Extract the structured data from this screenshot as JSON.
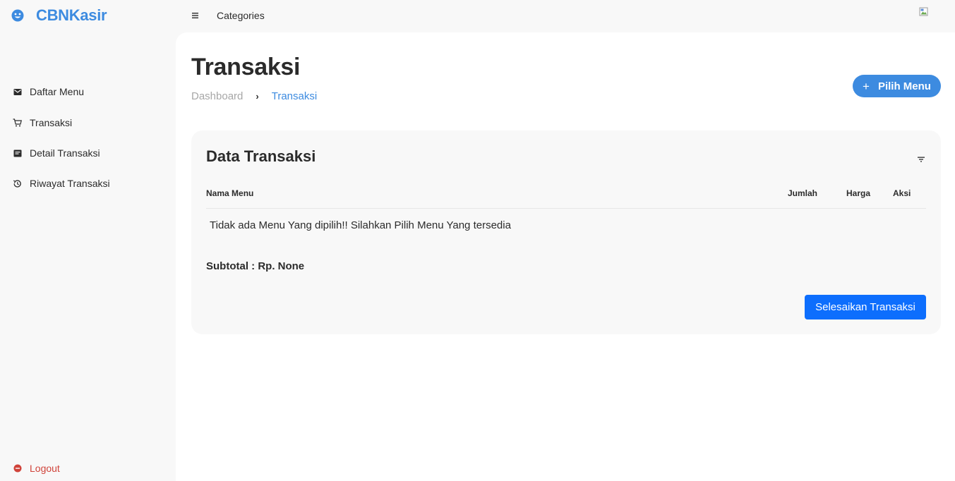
{
  "app": {
    "brand_name": "CBNKasir",
    "accent_color": "#3d8be0"
  },
  "topbar": {
    "menu_icon": "hamburger-icon",
    "link_label": "Categories"
  },
  "sidebar": {
    "items": [
      {
        "label": "Daftar Menu",
        "icon": "mail-icon"
      },
      {
        "label": "Transaksi",
        "icon": "cart-icon"
      },
      {
        "label": "Detail Transaksi",
        "icon": "receipt-icon"
      },
      {
        "label": "Riwayat Transaksi",
        "icon": "history-icon"
      }
    ],
    "logout_label": "Logout",
    "logout_color": "#d0433a"
  },
  "page": {
    "title": "Transaksi",
    "breadcrumb": {
      "home": "Dashboard",
      "separator": "›",
      "current": "Transaksi"
    },
    "pick_button": {
      "icon": "+",
      "label": "Pilih Menu"
    }
  },
  "card": {
    "title": "Data Transaksi",
    "table": {
      "columns": [
        "Nama Menu",
        "Jumlah",
        "Harga",
        "Aksi"
      ],
      "empty_message": "Tidak ada Menu Yang dipilih!! Silahkan Pilih Menu Yang tersedia"
    },
    "subtotal": "Subtotal : Rp. None",
    "finish_button": "Selesaikan Transaksi",
    "finish_color": "#0d6efd"
  }
}
